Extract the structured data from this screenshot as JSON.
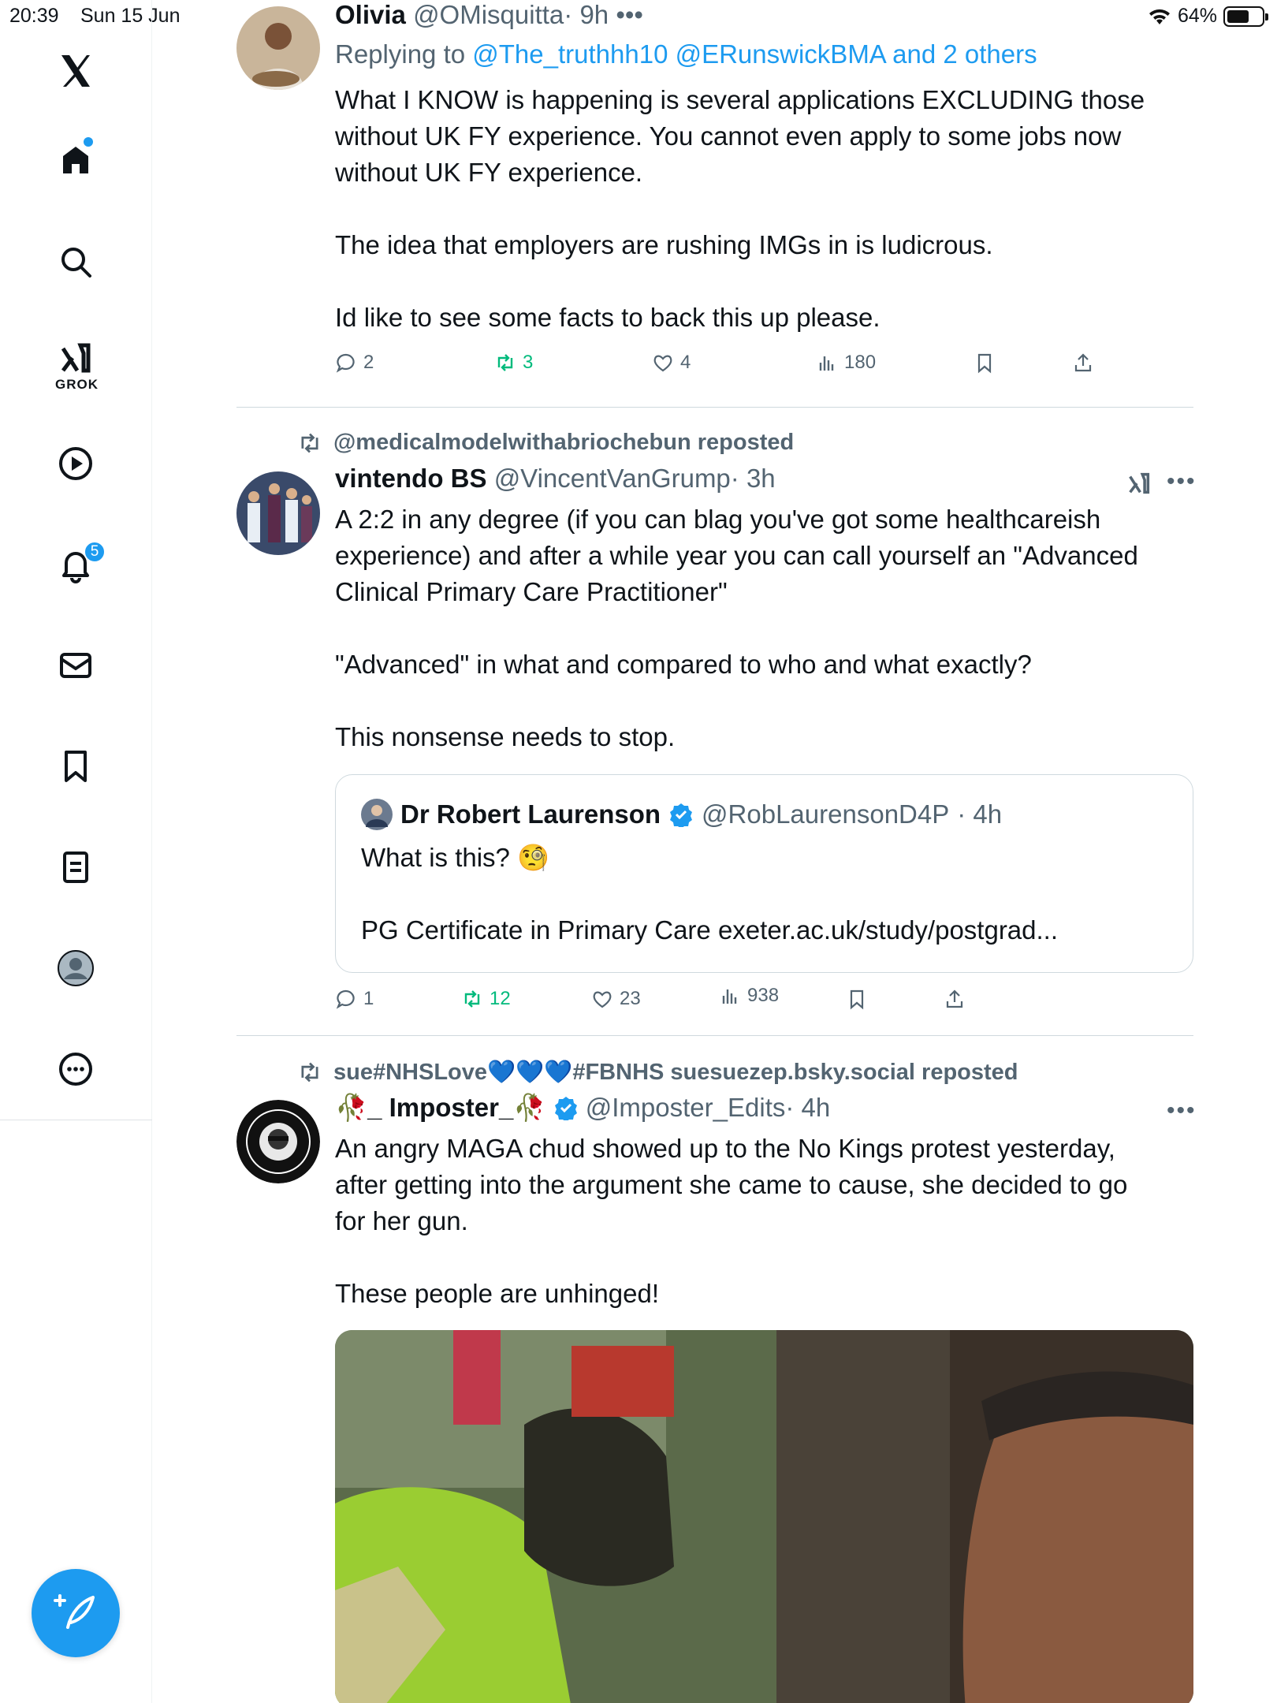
{
  "status_bar": {
    "time": "20:39",
    "date": "Sun 15 Jun",
    "battery": "64%"
  },
  "sidebar": {
    "logo": "x-logo-icon",
    "items": [
      {
        "name": "home",
        "icon": "home-icon"
      },
      {
        "name": "explore",
        "icon": "search-icon"
      },
      {
        "name": "grok",
        "icon": "grok-icon",
        "label": "GROK"
      },
      {
        "name": "videos",
        "icon": "play-icon"
      },
      {
        "name": "notifications",
        "icon": "bell-icon",
        "badge": "5"
      },
      {
        "name": "messages",
        "icon": "mail-icon"
      },
      {
        "name": "bookmarks",
        "icon": "bookmark-icon"
      },
      {
        "name": "lists",
        "icon": "list-icon"
      },
      {
        "name": "profile",
        "icon": "profile-icon"
      },
      {
        "name": "more",
        "icon": "more-icon"
      }
    ],
    "compose": "compose-icon"
  },
  "posts": [
    {
      "name": "Olivia",
      "handle": "@OMisquitta",
      "time": "· 9h",
      "more": "•••",
      "replying_prefix": "Replying to ",
      "replying_to": "@The_truthhh10 @ERunswickBMA and 2 others",
      "text": "What I KNOW is happening is several applications EXCLUDING those\nwithout UK FY experience. You cannot even apply to some jobs now\nwithout UK FY experience.\n\nThe idea that employers are rushing IMGs in is ludicrous.\n\nId like to see some facts to back this up please.",
      "replies": "2",
      "reposts": "3",
      "likes": "4",
      "views": "180"
    },
    {
      "reposted_by": "@medicalmodelwithabriochebun reposted",
      "name": "vintendo BS",
      "handle": "@VincentVanGrump",
      "time": "· 3h",
      "more": "•••",
      "text": "A 2:2 in any degree (if you can blag you've got some healthcareish\nexperience) and after a while year you can call yourself an \"Advanced\nClinical Primary Care Practitioner\"\n\n\"Advanced\" in what and compared to who and what exactly?\n\nThis nonsense needs to stop.",
      "quote": {
        "name": "Dr Robert Laurenson",
        "handle": "@RobLaurensonD4P",
        "time": "· 4h",
        "text": "What is this? 🧐\n\nPG Certificate in Primary Care exeter.ac.uk/study/postgrad..."
      },
      "replies": "1",
      "reposts": "12",
      "likes": "23",
      "views": "938"
    },
    {
      "reposted_by": "sue#NHSLove💙💙💙#FBNHS suesuezep.bsky.social reposted",
      "name": "🥀_ Imposter_🥀",
      "handle": "@Imposter_Edits",
      "time": "· 4h",
      "more": "•••",
      "text": "An angry MAGA chud showed up to the No Kings protest yesterday,\nafter getting into the argument she came to cause, she decided to go\nfor her gun.\n\nThese people are unhinged!"
    }
  ]
}
